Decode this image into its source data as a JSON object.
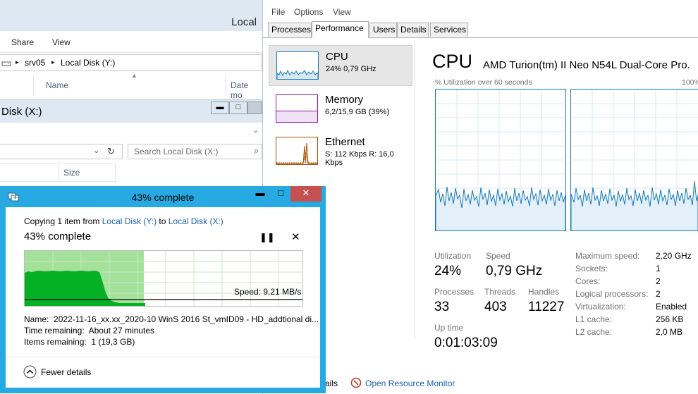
{
  "explorer_y": {
    "title": "Local",
    "ribbon": [
      "Share",
      "View"
    ],
    "path": [
      "srv05",
      "Local Disk (Y:)"
    ],
    "columns": [
      "Name",
      "Date mo"
    ]
  },
  "explorer_x": {
    "title": "Disk (X:)",
    "search_placeholder": "Search Local Disk (X:)",
    "columns": [
      "Size"
    ]
  },
  "taskmanager": {
    "menu": [
      "File",
      "Options",
      "View"
    ],
    "tabs": [
      "Processes",
      "Performance",
      "Users",
      "Details",
      "Services"
    ],
    "active_tab": "Performance",
    "sidebar": [
      {
        "name": "CPU",
        "sub": "24%  0,79 GHz"
      },
      {
        "name": "Memory",
        "sub": "6,2/15,9 GB (39%)"
      },
      {
        "name": "Ethernet",
        "sub_s_label": "S:",
        "sub_s": "112 Kbps",
        "sub_r_label": "R:",
        "sub_r": "16,0 Kbps"
      }
    ],
    "cpu_title": "CPU",
    "cpu_model": "AMD Turion(tm) II Neo N54L Dual-Core Pro.",
    "graph_label": "% Utilization over 60 seconds",
    "graph_max": "100%",
    "stats": {
      "utilization_label": "Utilization",
      "utilization": "24%",
      "speed_label": "Speed",
      "speed": "0,79 GHz",
      "processes_label": "Processes",
      "processes": "33",
      "threads_label": "Threads",
      "threads": "403",
      "handles_label": "Handles",
      "handles": "11227",
      "uptime_label": "Up time",
      "uptime": "0:01:03:09"
    },
    "info": [
      {
        "label": "Maximum speed:",
        "value": "2,20 GHz"
      },
      {
        "label": "Sockets:",
        "value": "1"
      },
      {
        "label": "Cores:",
        "value": "2"
      },
      {
        "label": "Logical processors:",
        "value": "2"
      },
      {
        "label": "Virtualization:",
        "value": "Enabled"
      },
      {
        "label": "L1 cache:",
        "value": "256 KB"
      },
      {
        "label": "L2 cache:",
        "value": "2,0 MB"
      }
    ],
    "footer_partial": "ails",
    "resource_monitor": "Open Resource Monitor"
  },
  "copy_dialog": {
    "title": "43% complete",
    "copying_prefix": "Copying 1 item from ",
    "from": "Local Disk (Y:)",
    "to_word": " to ",
    "to": "Local Disk (X:)",
    "heading": "43% complete",
    "progress": 0.43,
    "speed": "Speed: 9,21 MB/s",
    "name_label": "Name:",
    "name_value": "2022-11-16_xx.xx_2020-10 WinS 2016 St_vmID09 - HD_addtional di...",
    "time_label": "Time remaining:",
    "time_value": "About 27 minutes",
    "items_label": "Items remaining:",
    "items_value": "1 (19,3 GB)",
    "fewer_details": "Fewer details"
  },
  "colors": {
    "cpu_line": "#1479b8",
    "memory": "#8b12ae",
    "ethernet": "#a74f01",
    "copy_fill": "#a4e29b",
    "copy_graph": "#06b025",
    "dialog_frame": "#27a9e1",
    "close_red": "#c75050"
  }
}
